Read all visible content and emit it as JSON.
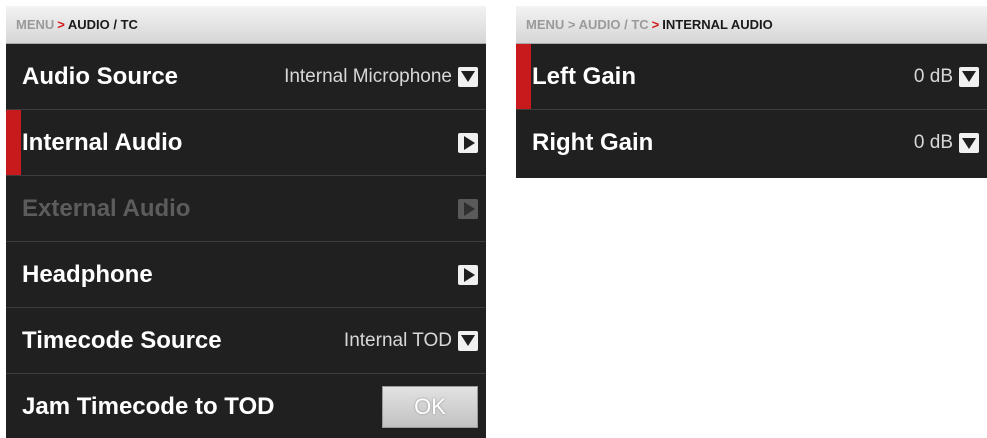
{
  "left_panel": {
    "breadcrumb": {
      "prev": "MENU",
      "sep": ">",
      "current": "AUDIO / TC"
    },
    "rows": [
      {
        "label": "Audio Source",
        "value": "Internal Microphone"
      },
      {
        "label": "Internal Audio"
      },
      {
        "label": "External Audio"
      },
      {
        "label": "Headphone"
      },
      {
        "label": "Timecode Source",
        "value": "Internal TOD"
      },
      {
        "label": "Jam Timecode to TOD",
        "button": "OK"
      }
    ]
  },
  "right_panel": {
    "breadcrumb": {
      "prev": "MENU > AUDIO / TC",
      "sep": ">",
      "current": "INTERNAL AUDIO"
    },
    "rows": [
      {
        "label": "Left Gain",
        "value": "0 dB"
      },
      {
        "label": "Right Gain",
        "value": "0 dB"
      }
    ]
  },
  "colors": {
    "panel_bg": "#202020",
    "selection_indicator": "#c8191d",
    "breadcrumb_separator": "#d01a1a"
  },
  "icons": {
    "dropdown": "chevron-down-icon",
    "submenu": "chevron-right-icon"
  }
}
